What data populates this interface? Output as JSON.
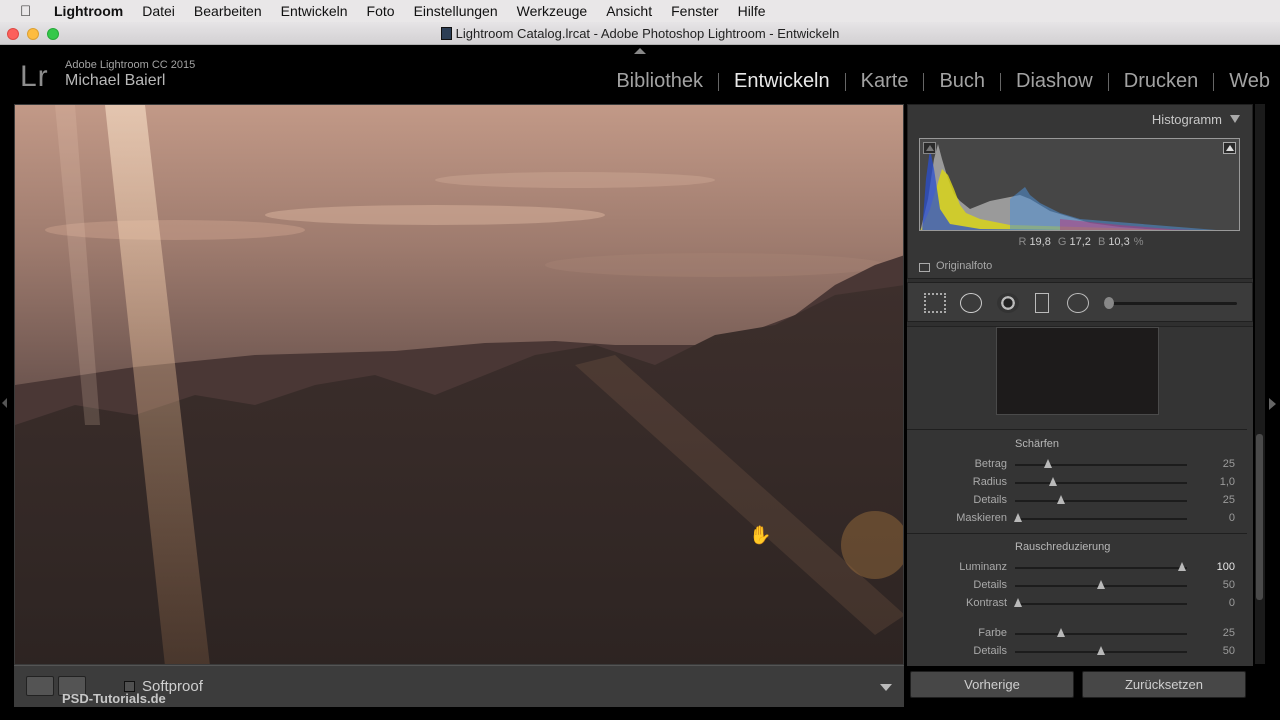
{
  "menubar": {
    "items": [
      "Lightroom",
      "Datei",
      "Bearbeiten",
      "Entwickeln",
      "Foto",
      "Einstellungen",
      "Werkzeuge",
      "Ansicht",
      "Fenster",
      "Hilfe"
    ]
  },
  "window": {
    "title": "Lightroom Catalog.lrcat - Adobe Photoshop Lightroom - Entwickeln"
  },
  "identity": {
    "logo": "Lr",
    "product": "Adobe Lightroom CC 2015",
    "user": "Michael Baierl"
  },
  "modules": {
    "items": [
      "Bibliothek",
      "Entwickeln",
      "Karte",
      "Buch",
      "Diashow",
      "Drucken",
      "Web"
    ],
    "active": "Entwickeln"
  },
  "toolbar": {
    "softproof_label": "Softproof",
    "watermark": "PSD-Tutorials.de"
  },
  "histogram": {
    "title": "Histogramm",
    "r_label": "R",
    "r_value": "19,8",
    "g_label": "G",
    "g_value": "17,2",
    "b_label": "B",
    "b_value": "10,3",
    "unit": "%",
    "original_label": "Originalfoto"
  },
  "detail": {
    "sharpen_title": "Schärfen",
    "sharpen": [
      {
        "label": "Betrag",
        "value": "25",
        "level": 0.19
      },
      {
        "label": "Radius",
        "value": "1,0",
        "level": 0.22
      },
      {
        "label": "Details",
        "value": "25",
        "level": 0.27
      },
      {
        "label": "Maskieren",
        "value": "0",
        "level": 0.02
      }
    ],
    "noise_title": "Rauschreduzierung",
    "noise": [
      {
        "label": "Luminanz",
        "value": "100",
        "level": 0.97
      },
      {
        "label": "Details",
        "value": "50",
        "level": 0.5
      },
      {
        "label": "Kontrast",
        "value": "0",
        "level": 0.02
      }
    ],
    "color": [
      {
        "label": "Farbe",
        "value": "25",
        "level": 0.27
      },
      {
        "label": "Details",
        "value": "50",
        "level": 0.5
      }
    ]
  },
  "buttons": {
    "previous": "Vorherige",
    "reset": "Zurücksetzen"
  },
  "colors": {
    "panel_bg": "#343434",
    "text_active": "#e8e8e8",
    "text_inactive": "#a2a2a2"
  }
}
